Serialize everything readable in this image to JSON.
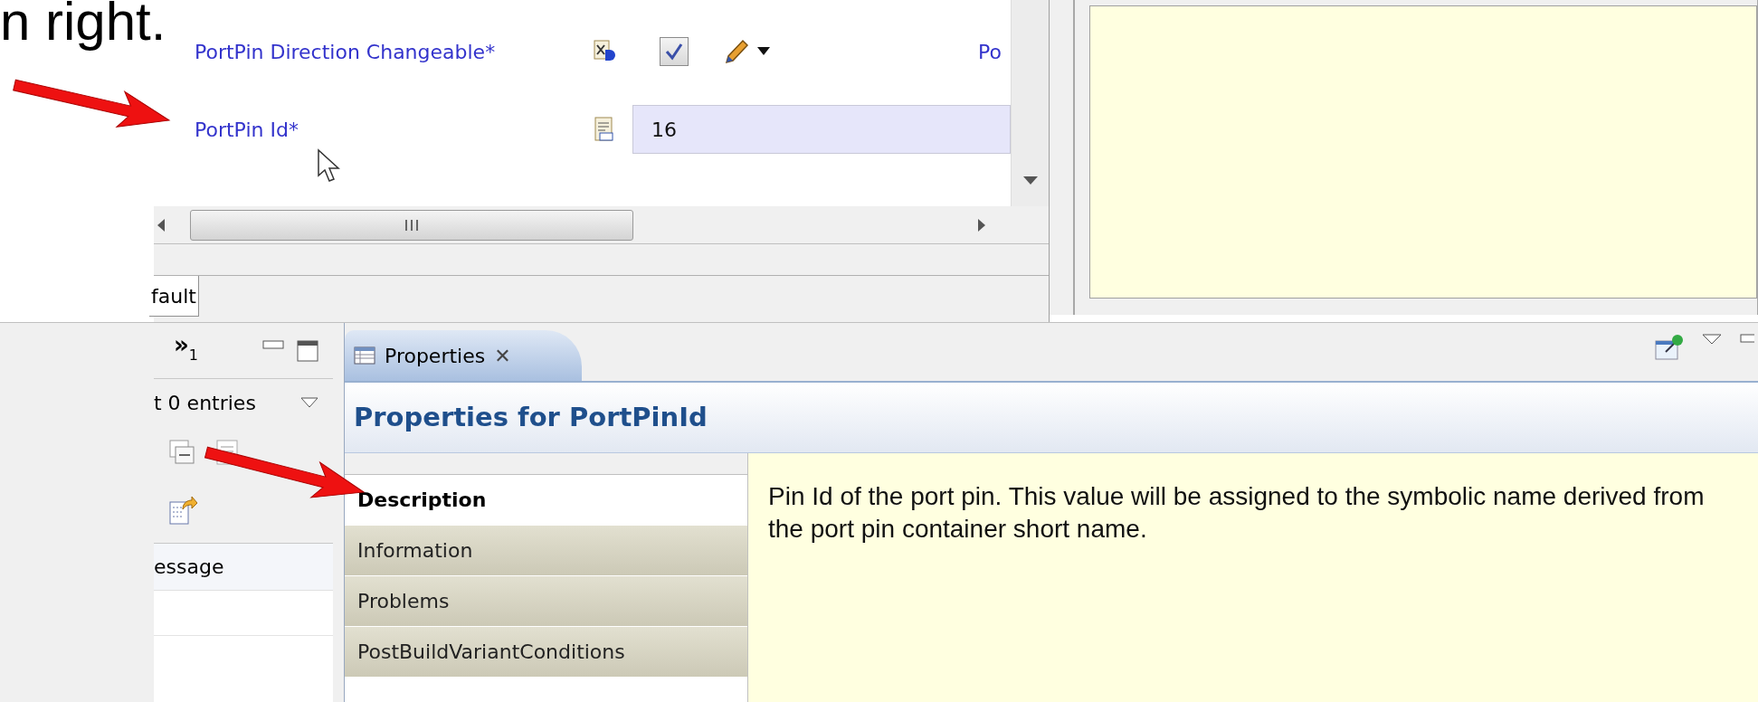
{
  "slide_text": "n right.",
  "editor": {
    "rows": [
      {
        "label": "PortPin Direction Changeable*",
        "kind": "checkbox",
        "checked": true,
        "trailing": "Po"
      },
      {
        "label": "PortPin Id*",
        "kind": "text",
        "value": "16"
      }
    ]
  },
  "editor_tabs": [
    {
      "label": "fault",
      "selected": true
    }
  ],
  "problems_view": {
    "overflow": "»",
    "overflow_count": "1",
    "summary": "t 0 entries",
    "column": "essage"
  },
  "properties_view": {
    "tab": "Properties",
    "close": "✕",
    "title": "Properties for PortPinId",
    "sections": [
      {
        "label": "Description",
        "selected": true
      },
      {
        "label": "Information",
        "selected": false
      },
      {
        "label": "Problems",
        "selected": false
      },
      {
        "label": "PostBuildVariantConditions",
        "selected": false
      }
    ],
    "description": "Pin Id of the port pin. This value will be assigned to the symbolic name derived from the port pin container short name."
  }
}
